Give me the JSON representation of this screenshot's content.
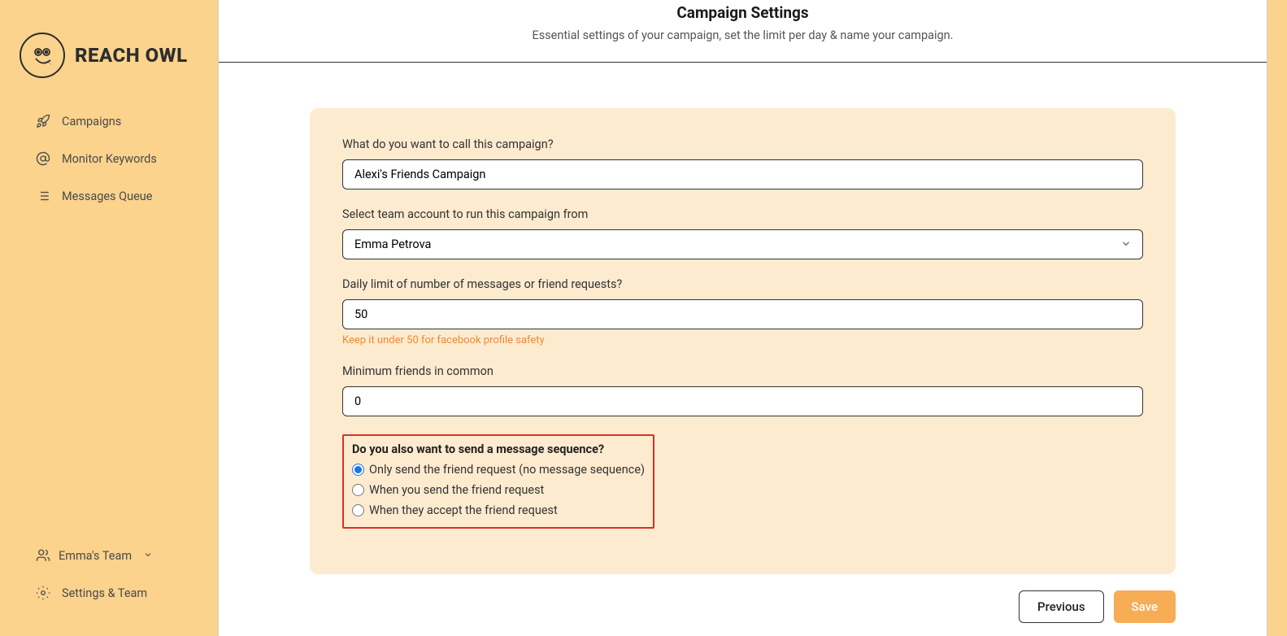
{
  "brand": {
    "name": "REACH OWL"
  },
  "sidebar": {
    "items": [
      {
        "label": "Campaigns",
        "icon": "rocket"
      },
      {
        "label": "Monitor Keywords",
        "icon": "at"
      },
      {
        "label": "Messages Queue",
        "icon": "list"
      }
    ],
    "team": {
      "label": "Emma's Team"
    },
    "settings": {
      "label": "Settings & Team"
    }
  },
  "header": {
    "title": "Campaign Settings",
    "subtitle": "Essential settings of your campaign, set the limit per day & name your campaign."
  },
  "form": {
    "campaign_name": {
      "label": "What do you want to call this campaign?",
      "value": "Alexi's Friends Campaign"
    },
    "team_account": {
      "label": "Select team account to run this campaign from",
      "value": "Emma Petrova"
    },
    "daily_limit": {
      "label": "Daily limit of number of messages or friend requests?",
      "value": "50",
      "helper": "Keep it under 50 for facebook profile safety"
    },
    "min_friends": {
      "label": "Minimum friends in common",
      "value": "0"
    },
    "message_sequence": {
      "question": "Do you also want to send a message sequence?",
      "options": [
        "Only send the friend request (no message sequence)",
        "When you send the friend request",
        "When they accept the friend request"
      ],
      "selected_index": 0
    }
  },
  "buttons": {
    "previous": "Previous",
    "save": "Save"
  }
}
